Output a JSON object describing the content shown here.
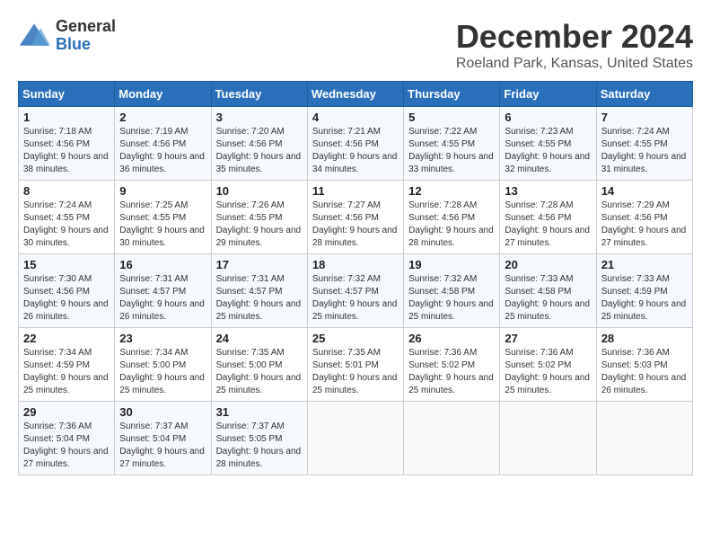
{
  "logo": {
    "general": "General",
    "blue": "Blue"
  },
  "title": "December 2024",
  "location": "Roeland Park, Kansas, United States",
  "days_of_week": [
    "Sunday",
    "Monday",
    "Tuesday",
    "Wednesday",
    "Thursday",
    "Friday",
    "Saturday"
  ],
  "weeks": [
    [
      {
        "day": "1",
        "sunrise": "7:18 AM",
        "sunset": "4:56 PM",
        "daylight": "9 hours and 38 minutes."
      },
      {
        "day": "2",
        "sunrise": "7:19 AM",
        "sunset": "4:56 PM",
        "daylight": "9 hours and 36 minutes."
      },
      {
        "day": "3",
        "sunrise": "7:20 AM",
        "sunset": "4:56 PM",
        "daylight": "9 hours and 35 minutes."
      },
      {
        "day": "4",
        "sunrise": "7:21 AM",
        "sunset": "4:56 PM",
        "daylight": "9 hours and 34 minutes."
      },
      {
        "day": "5",
        "sunrise": "7:22 AM",
        "sunset": "4:55 PM",
        "daylight": "9 hours and 33 minutes."
      },
      {
        "day": "6",
        "sunrise": "7:23 AM",
        "sunset": "4:55 PM",
        "daylight": "9 hours and 32 minutes."
      },
      {
        "day": "7",
        "sunrise": "7:24 AM",
        "sunset": "4:55 PM",
        "daylight": "9 hours and 31 minutes."
      }
    ],
    [
      {
        "day": "8",
        "sunrise": "7:24 AM",
        "sunset": "4:55 PM",
        "daylight": "9 hours and 30 minutes."
      },
      {
        "day": "9",
        "sunrise": "7:25 AM",
        "sunset": "4:55 PM",
        "daylight": "9 hours and 30 minutes."
      },
      {
        "day": "10",
        "sunrise": "7:26 AM",
        "sunset": "4:55 PM",
        "daylight": "9 hours and 29 minutes."
      },
      {
        "day": "11",
        "sunrise": "7:27 AM",
        "sunset": "4:56 PM",
        "daylight": "9 hours and 28 minutes."
      },
      {
        "day": "12",
        "sunrise": "7:28 AM",
        "sunset": "4:56 PM",
        "daylight": "9 hours and 28 minutes."
      },
      {
        "day": "13",
        "sunrise": "7:28 AM",
        "sunset": "4:56 PM",
        "daylight": "9 hours and 27 minutes."
      },
      {
        "day": "14",
        "sunrise": "7:29 AM",
        "sunset": "4:56 PM",
        "daylight": "9 hours and 27 minutes."
      }
    ],
    [
      {
        "day": "15",
        "sunrise": "7:30 AM",
        "sunset": "4:56 PM",
        "daylight": "9 hours and 26 minutes."
      },
      {
        "day": "16",
        "sunrise": "7:31 AM",
        "sunset": "4:57 PM",
        "daylight": "9 hours and 26 minutes."
      },
      {
        "day": "17",
        "sunrise": "7:31 AM",
        "sunset": "4:57 PM",
        "daylight": "9 hours and 25 minutes."
      },
      {
        "day": "18",
        "sunrise": "7:32 AM",
        "sunset": "4:57 PM",
        "daylight": "9 hours and 25 minutes."
      },
      {
        "day": "19",
        "sunrise": "7:32 AM",
        "sunset": "4:58 PM",
        "daylight": "9 hours and 25 minutes."
      },
      {
        "day": "20",
        "sunrise": "7:33 AM",
        "sunset": "4:58 PM",
        "daylight": "9 hours and 25 minutes."
      },
      {
        "day": "21",
        "sunrise": "7:33 AM",
        "sunset": "4:59 PM",
        "daylight": "9 hours and 25 minutes."
      }
    ],
    [
      {
        "day": "22",
        "sunrise": "7:34 AM",
        "sunset": "4:59 PM",
        "daylight": "9 hours and 25 minutes."
      },
      {
        "day": "23",
        "sunrise": "7:34 AM",
        "sunset": "5:00 PM",
        "daylight": "9 hours and 25 minutes."
      },
      {
        "day": "24",
        "sunrise": "7:35 AM",
        "sunset": "5:00 PM",
        "daylight": "9 hours and 25 minutes."
      },
      {
        "day": "25",
        "sunrise": "7:35 AM",
        "sunset": "5:01 PM",
        "daylight": "9 hours and 25 minutes."
      },
      {
        "day": "26",
        "sunrise": "7:36 AM",
        "sunset": "5:02 PM",
        "daylight": "9 hours and 25 minutes."
      },
      {
        "day": "27",
        "sunrise": "7:36 AM",
        "sunset": "5:02 PM",
        "daylight": "9 hours and 25 minutes."
      },
      {
        "day": "28",
        "sunrise": "7:36 AM",
        "sunset": "5:03 PM",
        "daylight": "9 hours and 26 minutes."
      }
    ],
    [
      {
        "day": "29",
        "sunrise": "7:36 AM",
        "sunset": "5:04 PM",
        "daylight": "9 hours and 27 minutes."
      },
      {
        "day": "30",
        "sunrise": "7:37 AM",
        "sunset": "5:04 PM",
        "daylight": "9 hours and 27 minutes."
      },
      {
        "day": "31",
        "sunrise": "7:37 AM",
        "sunset": "5:05 PM",
        "daylight": "9 hours and 28 minutes."
      },
      null,
      null,
      null,
      null
    ]
  ]
}
